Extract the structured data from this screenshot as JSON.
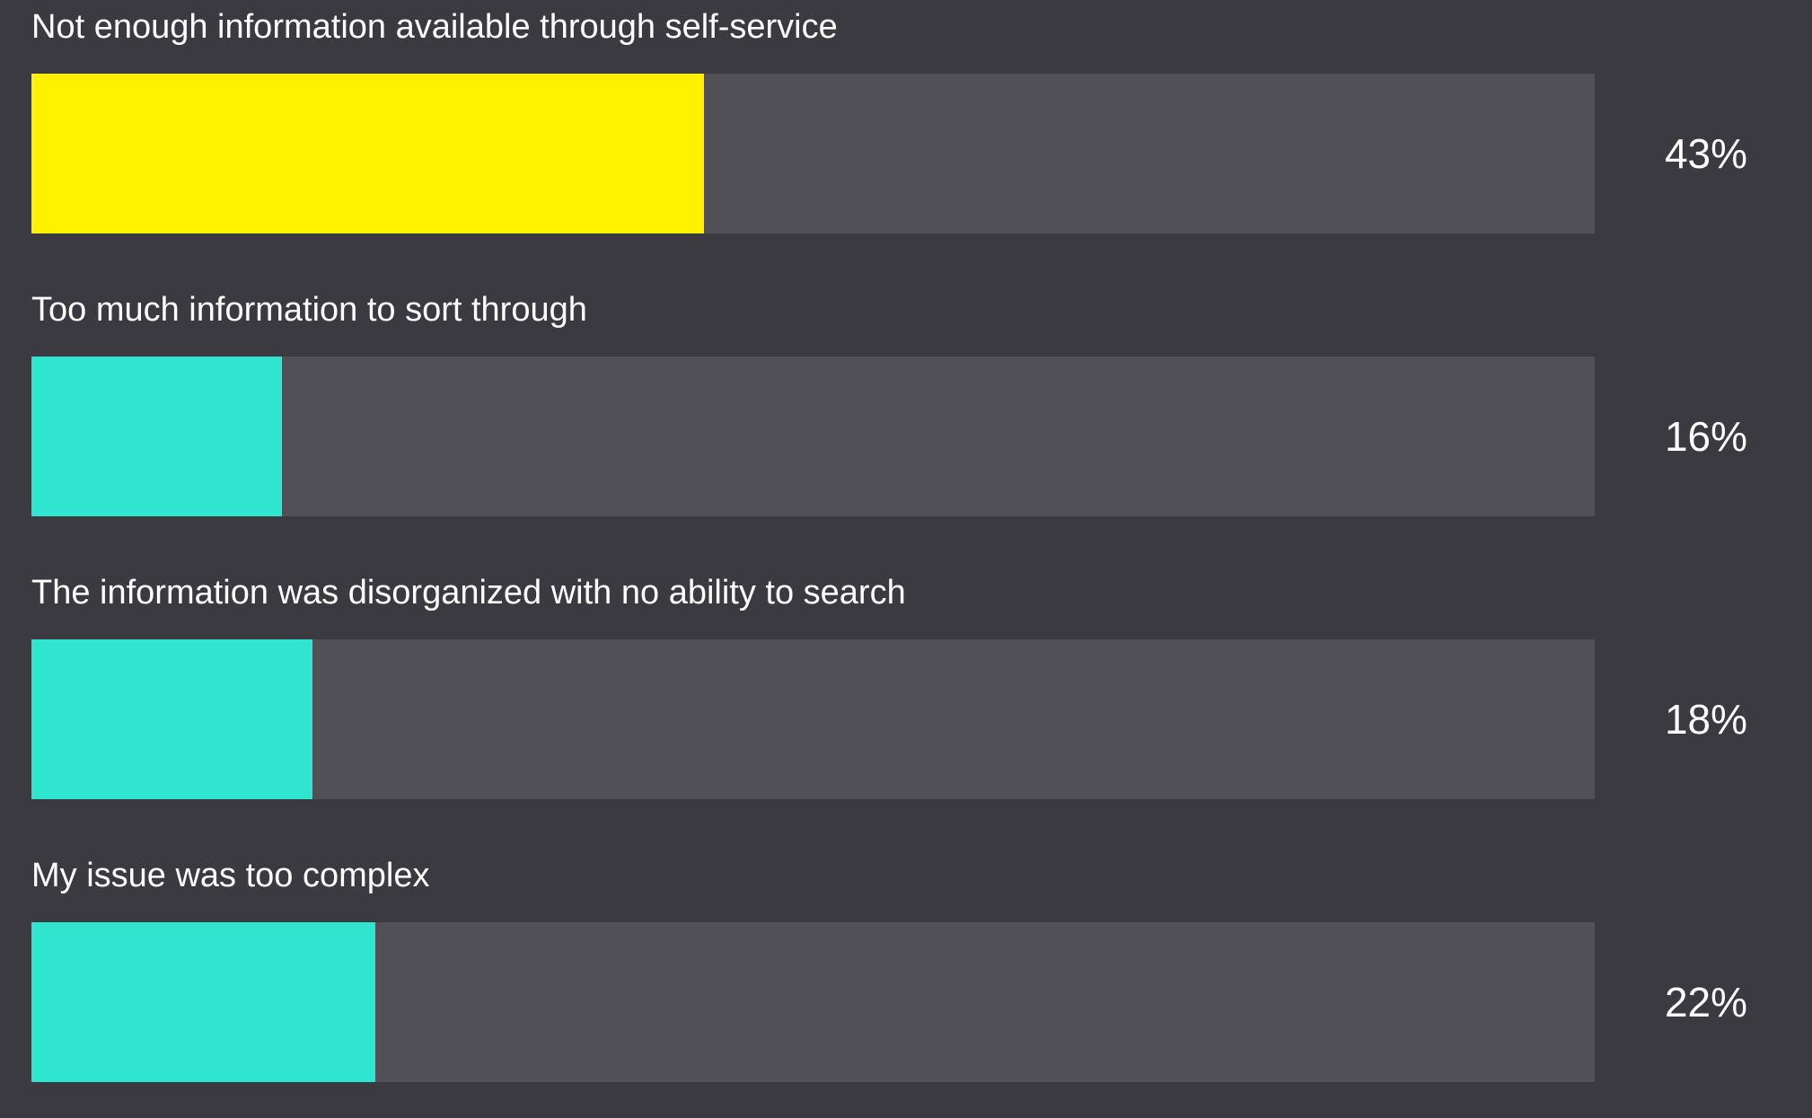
{
  "chart_data": {
    "type": "bar",
    "orientation": "horizontal",
    "categories": [
      "Not enough information available through self-service",
      "Too much information to sort through",
      "The information was disorganized with no ability to search",
      "My issue was too complex"
    ],
    "values": [
      43,
      16,
      18,
      22
    ],
    "value_labels": [
      "43%",
      "16%",
      "18%",
      "22%"
    ],
    "unit": "%",
    "xlim": [
      0,
      100
    ],
    "grid": false,
    "legend": "none",
    "highlight_index": 0
  },
  "colors": {
    "background": "#3b3a40",
    "track": "#505056",
    "highlight": "#fff100",
    "bar": "#30e5d0",
    "text": "#ffffff"
  }
}
